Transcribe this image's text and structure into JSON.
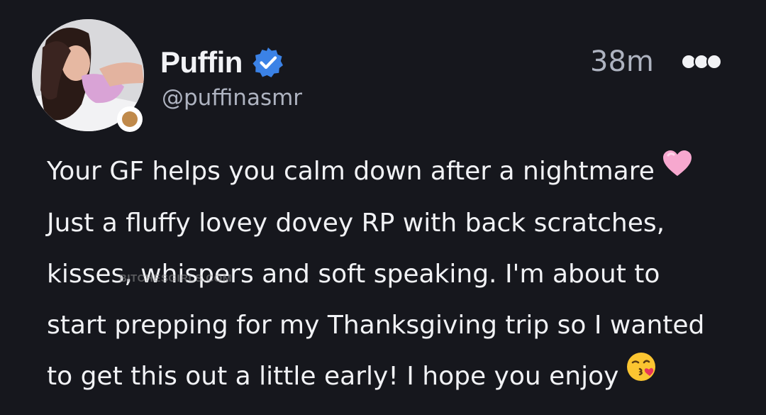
{
  "post": {
    "author": {
      "display_name": "Puffin",
      "handle": "@puffinasmr",
      "verified_icon": "verified-badge-icon",
      "avatar_icon": "profile-photo",
      "status_color": "#c08a4b"
    },
    "timestamp": "38m",
    "menu_icon": "more-options-icon",
    "lines": [
      "Your GF helps you calm down after a nightmare",
      "Just a fluffy lovey dovey RP with back scratches,",
      "kisses, whispers and soft speaking. I'm about to",
      "start prepping for my Thanksgiving trip so I wanted",
      "to get this out a little early! I hope you enjoy"
    ],
    "emojis": {
      "line1": "pink-heart-emoji",
      "line5": "kissing-face-emoji"
    },
    "watermark": "BITCHESGIRLS.COM"
  },
  "colors": {
    "background": "#16171d",
    "verified_blue": "#3b82e6",
    "text": "#f1f2f5",
    "muted": "#aeb3c0"
  }
}
